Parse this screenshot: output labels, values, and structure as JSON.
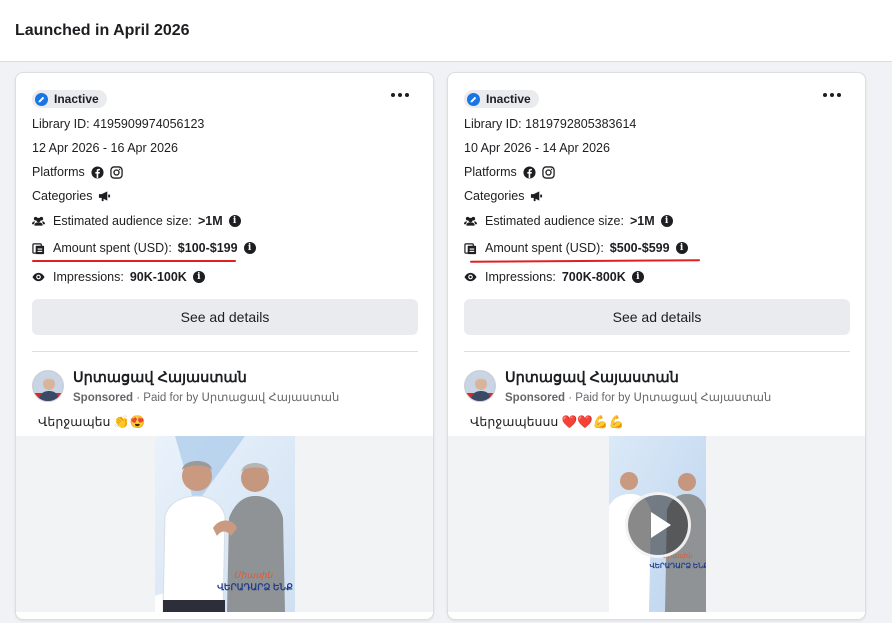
{
  "header": {
    "title": "Launched in April 2026"
  },
  "cards": [
    {
      "status": "Inactive",
      "library_id": "Library ID: 4195909974056123",
      "dates": "12 Apr 2026 - 16 Apr 2026",
      "platforms_label": "Platforms",
      "categories_label": "Categories",
      "audience_label": "Estimated audience size:",
      "audience_value": ">1M",
      "amount_label": "Amount spent (USD):",
      "amount_value": "$100-$199",
      "impressions_label": "Impressions:",
      "impressions_value": "90K-100K",
      "details_button": "See ad details",
      "page_name": "Սրտացավ Հայաստան",
      "sponsored": "Sponsored",
      "paid_for": " · Paid for by Սրտացավ Հայաստան",
      "body": "Վերջապես 👏😍",
      "media_type": "image",
      "media_caption": "ՎԵՐԱԴԱՐՁ ԵՆՔ"
    },
    {
      "status": "Inactive",
      "library_id": "Library ID: 1819792805383614",
      "dates": "10 Apr 2026 - 14 Apr 2026",
      "platforms_label": "Platforms",
      "categories_label": "Categories",
      "audience_label": "Estimated audience size:",
      "audience_value": ">1M",
      "amount_label": "Amount spent (USD):",
      "amount_value": "$500-$599",
      "impressions_label": "Impressions:",
      "impressions_value": "700K-800K",
      "details_button": "See ad details",
      "page_name": "Սրտացավ Հայաստան",
      "sponsored": "Sponsored",
      "paid_for": " · Paid for by Սրտացավ Հայաստան",
      "body": "Վերջապեսսս ❤️❤️💪💪",
      "media_type": "video",
      "media_caption": "ՎԵՐԱԴԱՐՁ ԵՆՔ"
    }
  ],
  "icons": {
    "status": "check-circle-icon",
    "more": "more-options-icon",
    "platforms": [
      "facebook-icon",
      "instagram-icon"
    ],
    "categories": "megaphone-icon",
    "audience": "people-icon",
    "amount": "money-stack-icon",
    "impressions": "eye-icon",
    "info": "info-icon",
    "play": "play-icon"
  },
  "colors": {
    "accent": "#1b74e4",
    "annotation": "#e02020",
    "button_bg": "#e9ebee"
  }
}
